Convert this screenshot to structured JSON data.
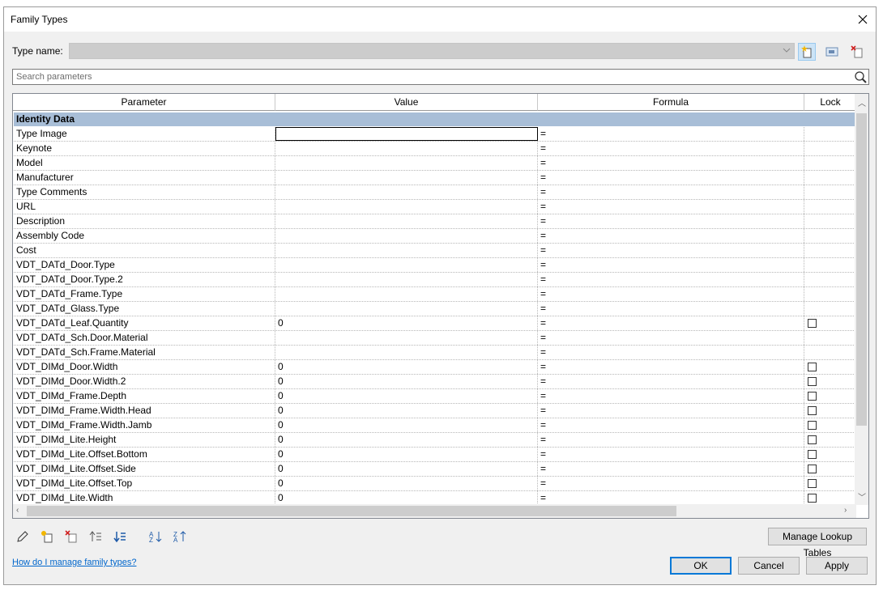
{
  "window": {
    "title": "Family Types"
  },
  "type_name": {
    "label": "Type name:",
    "value": ""
  },
  "search": {
    "placeholder": "Search parameters"
  },
  "grid": {
    "headers": {
      "parameter": "Parameter",
      "value": "Value",
      "formula": "Formula",
      "lock": "Lock"
    },
    "group": "Identity Data",
    "rows": [
      {
        "parameter": "Type Image",
        "value": "",
        "formula": "=",
        "lock": false
      },
      {
        "parameter": "Keynote",
        "value": "",
        "formula": "=",
        "lock": false
      },
      {
        "parameter": "Model",
        "value": "",
        "formula": "=",
        "lock": false
      },
      {
        "parameter": "Manufacturer",
        "value": "",
        "formula": "=",
        "lock": false
      },
      {
        "parameter": "Type Comments",
        "value": "",
        "formula": "=",
        "lock": false
      },
      {
        "parameter": "URL",
        "value": "",
        "formula": "=",
        "lock": false
      },
      {
        "parameter": "Description",
        "value": "",
        "formula": "=",
        "lock": false
      },
      {
        "parameter": "Assembly Code",
        "value": "",
        "formula": "=",
        "lock": false
      },
      {
        "parameter": "Cost",
        "value": "",
        "formula": "=",
        "lock": false
      },
      {
        "parameter": "VDT_DATd_Door.Type",
        "value": "",
        "formula": "=",
        "lock": false
      },
      {
        "parameter": "VDT_DATd_Door.Type.2",
        "value": "",
        "formula": "=",
        "lock": false
      },
      {
        "parameter": "VDT_DATd_Frame.Type",
        "value": "",
        "formula": "=",
        "lock": false
      },
      {
        "parameter": "VDT_DATd_Glass.Type",
        "value": "",
        "formula": "=",
        "lock": false
      },
      {
        "parameter": "VDT_DATd_Leaf.Quantity",
        "value": "0",
        "formula": "=",
        "lock": true
      },
      {
        "parameter": "VDT_DATd_Sch.Door.Material",
        "value": "",
        "formula": "=",
        "lock": false
      },
      {
        "parameter": "VDT_DATd_Sch.Frame.Material",
        "value": "",
        "formula": "=",
        "lock": false
      },
      {
        "parameter": "VDT_DIMd_Door.Width",
        "value": "0",
        "formula": "=",
        "lock": true
      },
      {
        "parameter": "VDT_DIMd_Door.Width.2",
        "value": "0",
        "formula": "=",
        "lock": true
      },
      {
        "parameter": "VDT_DIMd_Frame.Depth",
        "value": "0",
        "formula": "=",
        "lock": true
      },
      {
        "parameter": "VDT_DIMd_Frame.Width.Head",
        "value": "0",
        "formula": "=",
        "lock": true
      },
      {
        "parameter": "VDT_DIMd_Frame.Width.Jamb",
        "value": "0",
        "formula": "=",
        "lock": true
      },
      {
        "parameter": "VDT_DIMd_Lite.Height",
        "value": "0",
        "formula": "=",
        "lock": true
      },
      {
        "parameter": "VDT_DIMd_Lite.Offset.Bottom",
        "value": "0",
        "formula": "=",
        "lock": true
      },
      {
        "parameter": "VDT_DIMd_Lite.Offset.Side",
        "value": "0",
        "formula": "=",
        "lock": true
      },
      {
        "parameter": "VDT_DIMd_Lite.Offset.Top",
        "value": "0",
        "formula": "=",
        "lock": true
      },
      {
        "parameter": "VDT_DIMd_Lite.Width",
        "value": "0",
        "formula": "=",
        "lock": true
      }
    ]
  },
  "buttons": {
    "manage_lookup": "Manage Lookup Tables",
    "ok": "OK",
    "cancel": "Cancel",
    "apply": "Apply"
  },
  "help_link": "How do I manage family types?",
  "colors": {
    "group_header": "#a8bed7",
    "accent": "#0078d7",
    "link": "#0066cc"
  }
}
